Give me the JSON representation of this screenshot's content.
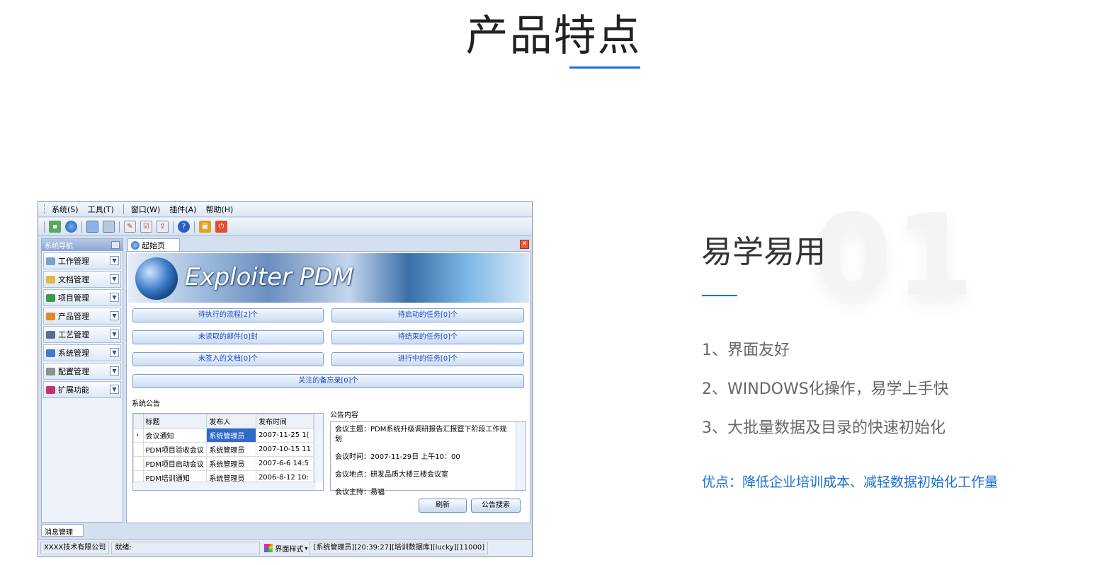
{
  "page": {
    "title": "产品特点"
  },
  "app": {
    "menu": [
      "系统(S)",
      "工具(T)",
      "窗口(W)",
      "插件(A)",
      "帮助(H)"
    ],
    "toolbar_icons": [
      "new-icon",
      "globe-icon",
      "window-icon",
      "list-icon",
      "edit-icon",
      "checklist-icon",
      "export-icon",
      "help-icon",
      "lock-icon",
      "power-icon"
    ],
    "sidebar": {
      "header": "系统导航",
      "items": [
        {
          "label": "工作管理",
          "icon": "grid-icon",
          "color": "#7aa0d4"
        },
        {
          "label": "文档管理",
          "icon": "folder-icon",
          "color": "#e3b74a"
        },
        {
          "label": "项目管理",
          "icon": "book-icon",
          "color": "#3c9a4a"
        },
        {
          "label": "产品管理",
          "icon": "product-icon",
          "color": "#e08a2c"
        },
        {
          "label": "工艺管理",
          "icon": "process-icon",
          "color": "#5a6f8f"
        },
        {
          "label": "系统管理",
          "icon": "system-icon",
          "color": "#3d7bd4"
        },
        {
          "label": "配置管理",
          "icon": "config-icon",
          "color": "#8f8f8f"
        },
        {
          "label": "扩展功能",
          "icon": "extension-icon",
          "color": "#c6306a"
        }
      ]
    },
    "tab": {
      "label": "起始页"
    },
    "banner_text": "Exploiter PDM",
    "tasks": {
      "pending_flow": "待执行的流程[2]个",
      "pending_start": "待启动的任务[0]个",
      "unread_mail": "未读取的邮件[0]封",
      "pending_finish": "待结束的任务[0]个",
      "unsigned_docs": "未签入的文档[0]个",
      "in_progress": "进行中的任务[0]个",
      "memo": "关注的备忘录[0]个"
    },
    "announcements": {
      "label": "系统公告",
      "columns": [
        "标题",
        "发布人",
        "发布时间"
      ],
      "rows": [
        [
          "会议通知",
          "系统管理员",
          "2007-11-25 1("
        ],
        [
          "PDM项目验收会议",
          "系统管理员",
          "2007-10-15 11"
        ],
        [
          "PDM项目启动会议",
          "系统管理员",
          "2007-6-6 14:5"
        ],
        [
          "PDM培训通知",
          "系统管理员",
          "2006-8-12 10:"
        ]
      ]
    },
    "notice": {
      "label": "公告内容",
      "lines": [
        "会议主题：PDM系统升级调研报告汇报暨下阶段工作规划",
        "会议时间：2007-11-29日 上午10：00",
        "会议地点：研发品质大楼三楼会议室",
        "会议主持：易福"
      ]
    },
    "buttons": {
      "refresh": "刷新",
      "search": "公告搜索"
    },
    "bottom_tab": "消息管理",
    "status": {
      "company": "XXXX技术有限公司",
      "state": "就绪:",
      "style": "界面样式",
      "info": "[系统管理员][20:39:27][培训数据库][lucky][11000]"
    }
  },
  "feature": {
    "number": "01",
    "title": "易学易用",
    "items": [
      "1、界面友好",
      "2、WINDOWS化操作，易学上手快",
      "3、大批量数据及目录的快速初始化"
    ],
    "advantage": "优点：降低企业培训成本、减轻数据初始化工作量"
  },
  "colors": {
    "accent": "#1a6fd0"
  }
}
